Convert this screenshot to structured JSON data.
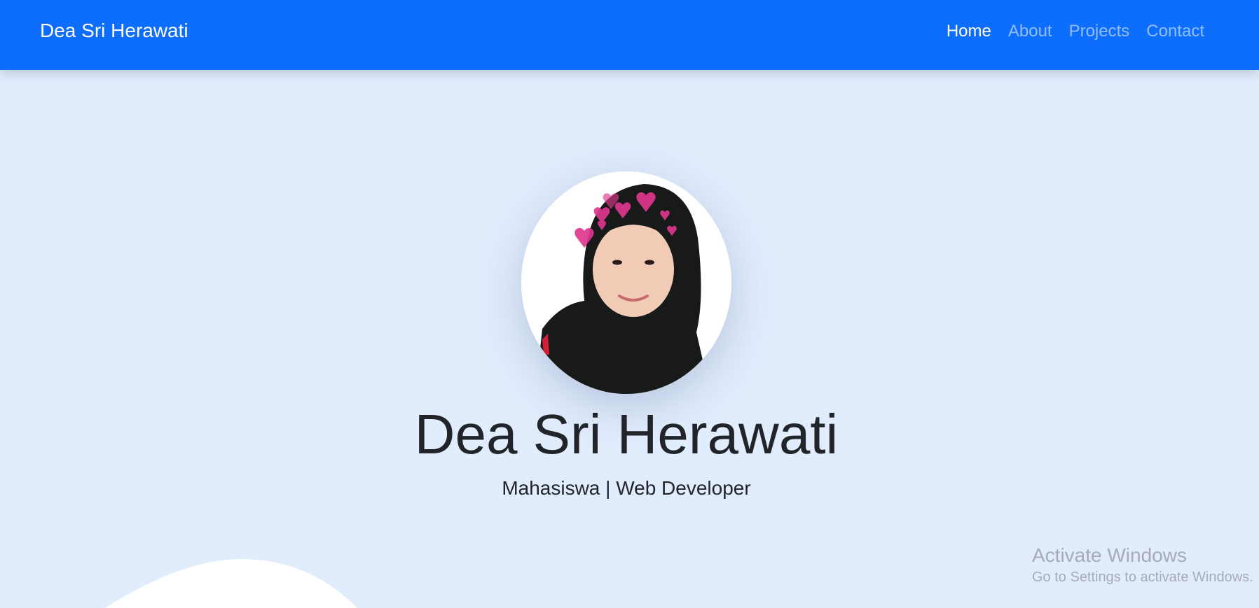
{
  "navbar": {
    "brand": "Dea Sri Herawati",
    "links": [
      {
        "label": "Home",
        "active": true
      },
      {
        "label": "About",
        "active": false
      },
      {
        "label": "Projects",
        "active": false
      },
      {
        "label": "Contact",
        "active": false
      }
    ]
  },
  "hero": {
    "name": "Dea Sri Herawati",
    "role": "Mahasiswa | Web Developer",
    "avatar_icon": "profile-photo"
  },
  "overlay": {
    "activate_title": "Activate Windows",
    "activate_subtitle": "Go to Settings to activate Windows."
  },
  "colors": {
    "navbar": "#0d6efd",
    "background": "#e1ecfd",
    "text": "#212529"
  }
}
